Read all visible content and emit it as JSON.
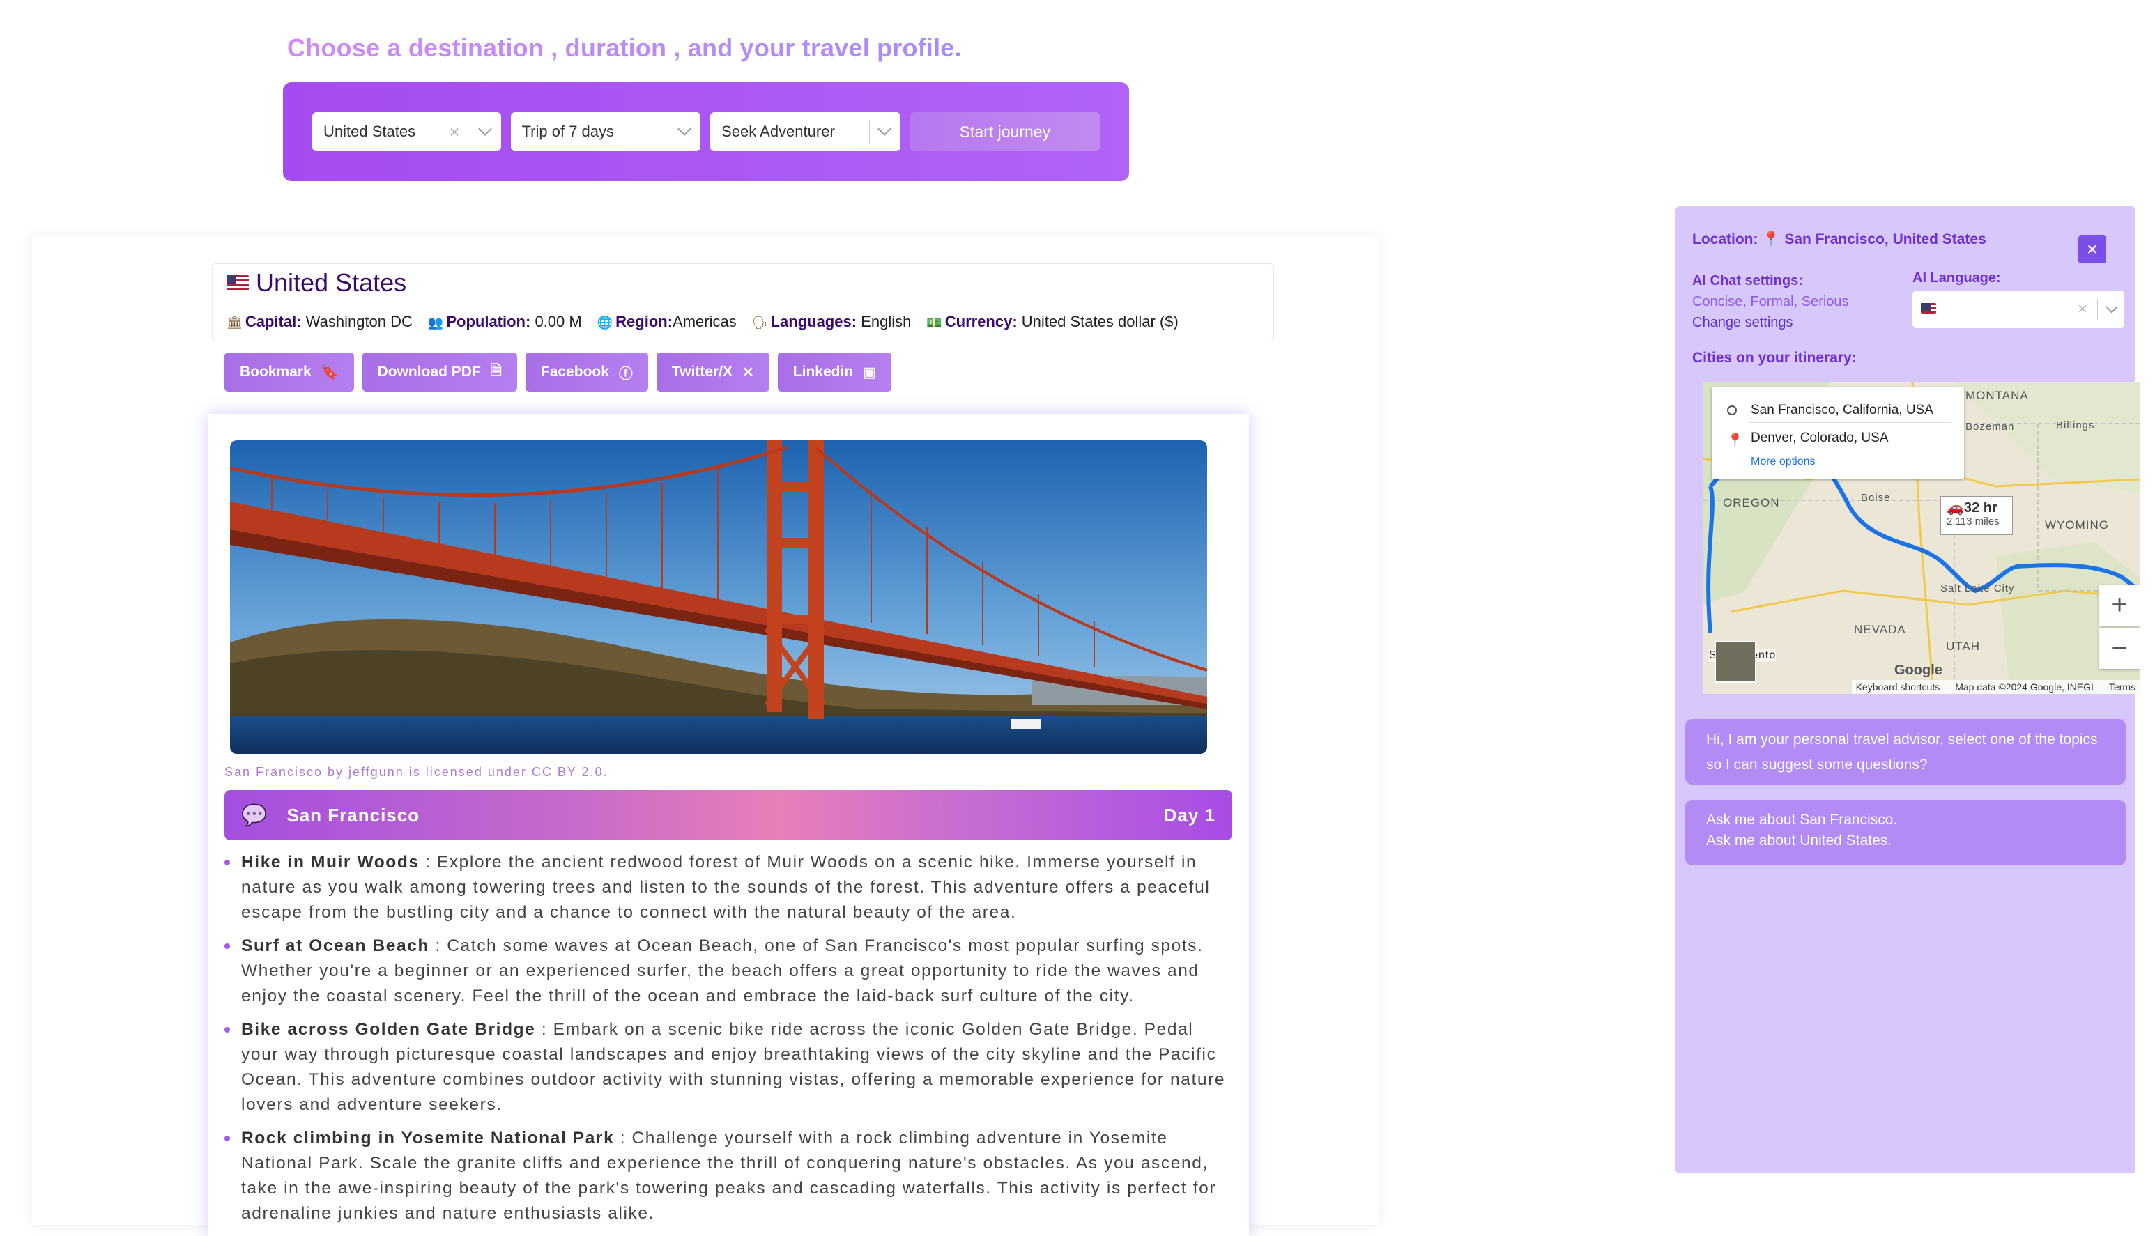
{
  "headline": "Choose a destination , duration , and your travel profile.",
  "selectors": {
    "destination": "United States",
    "duration": "Trip of 7 days",
    "profile": "Seek Adventurer",
    "start_label": "Start journey"
  },
  "country": {
    "name": "United States",
    "capital_label": "Capital:",
    "capital": "Washington DC",
    "population_label": "Population:",
    "population": "0.00 M",
    "region_label": "Region:",
    "region": "Americas",
    "languages_label": "Languages:",
    "languages": "English",
    "currency_label": "Currency:",
    "currency": "United States dollar ($)"
  },
  "actions": {
    "bookmark": "Bookmark",
    "download_pdf": "Download PDF",
    "facebook": "Facebook",
    "twitter": "Twitter/X",
    "linkedin": "Linkedin"
  },
  "itinerary": {
    "photo_credit": "San Francisco by jeffgunn is licensed under CC BY 2.0.",
    "city": "San Francisco",
    "day": "Day 1",
    "activities": [
      {
        "title": "Hike in Muir Woods",
        "desc": " : Explore the ancient redwood forest of Muir Woods on a scenic hike. Immerse yourself in nature as you walk among towering trees and listen to the sounds of the forest. This adventure offers a peaceful escape from the bustling city and a chance to connect with the natural beauty of the area."
      },
      {
        "title": "Surf at Ocean Beach",
        "desc": " : Catch some waves at Ocean Beach, one of San Francisco's most popular surfing spots. Whether you're a beginner or an experienced surfer, the beach offers a great opportunity to ride the waves and enjoy the coastal scenery. Feel the thrill of the ocean and embrace the laid-back surf culture of the city."
      },
      {
        "title": "Bike across Golden Gate Bridge",
        "desc": " : Embark on a scenic bike ride across the iconic Golden Gate Bridge. Pedal your way through picturesque coastal landscapes and enjoy breathtaking views of the city skyline and the Pacific Ocean. This adventure combines outdoor activity with stunning vistas, offering a memorable experience for nature lovers and adventure seekers."
      },
      {
        "title": "Rock climbing in Yosemite National Park",
        "desc": " : Challenge yourself with a rock climbing adventure in Yosemite National Park. Scale the granite cliffs and experience the thrill of conquering nature's obstacles. As you ascend, take in the awe-inspiring beauty of the park's towering peaks and cascading waterfalls. This activity is perfect for adrenaline junkies and nature enthusiasts alike."
      }
    ]
  },
  "panel": {
    "location_label": "Location:",
    "location": "San Francisco, United States",
    "close_label": "×",
    "chat_settings_label": "AI Chat settings:",
    "chat_settings_value": "Concise, Formal, Serious",
    "change_settings": "Change settings",
    "language_label": "AI Language:",
    "cities_label": "Cities on your itinerary:",
    "map": {
      "origin": "San Francisco, California, USA",
      "destination": "Denver, Colorado, USA",
      "more_options": "More options",
      "duration": "32 hr",
      "distance": "2,113 miles",
      "labels": [
        "MONTANA",
        "Billings",
        "Bozeman",
        "OREGON",
        "Boise",
        "WYOMING",
        "Salt Lake City",
        "NEVADA",
        "UTAH",
        "Sacramento"
      ],
      "keyboard": "Keyboard shortcuts",
      "mapdata": "Map data ©2024 Google, INEGI",
      "terms": "Terms",
      "google": "Google"
    },
    "greeting": "Hi, I am your personal travel advisor, select one of the topics so I can suggest some questions?",
    "suggestions": [
      "Ask me about San Francisco.",
      "Ask me about United States."
    ]
  },
  "colors": {
    "accent": "#a64ff0",
    "panel_bg": "#d8c7fb",
    "bubble": "#b28bf5"
  }
}
